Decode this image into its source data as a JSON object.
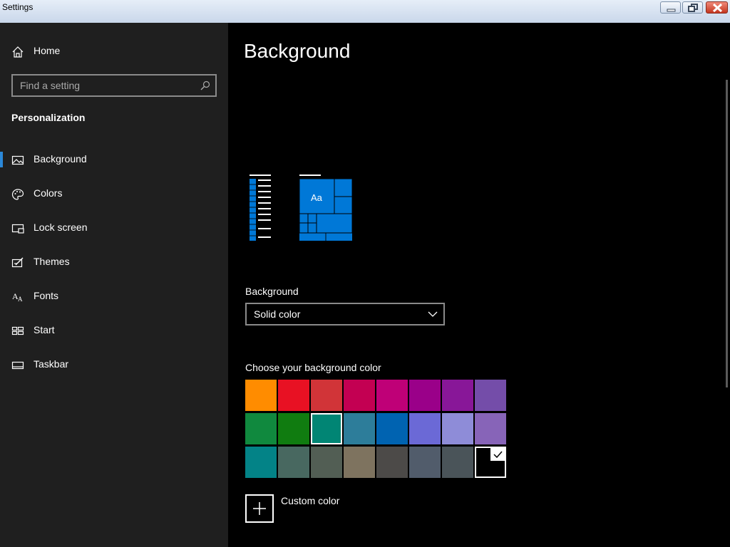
{
  "window": {
    "title": "Settings",
    "controls": {
      "minimize": "minimize",
      "maximize": "restore",
      "close": "close"
    }
  },
  "sidebar": {
    "home_label": "Home",
    "search_placeholder": "Find a setting",
    "section_title": "Personalization",
    "items": [
      {
        "label": "Background",
        "icon": "picture-icon",
        "active": true
      },
      {
        "label": "Colors",
        "icon": "palette-icon",
        "active": false
      },
      {
        "label": "Lock screen",
        "icon": "lock-screen-icon",
        "active": false
      },
      {
        "label": "Themes",
        "icon": "themes-icon",
        "active": false
      },
      {
        "label": "Fonts",
        "icon": "fonts-icon",
        "active": false
      },
      {
        "label": "Start",
        "icon": "start-icon",
        "active": false
      },
      {
        "label": "Taskbar",
        "icon": "taskbar-icon",
        "active": false
      }
    ],
    "accent_color": "#2b88d8"
  },
  "main": {
    "title": "Background",
    "preview": {
      "tile_text": "Aa",
      "accent": "#0078d7"
    },
    "background_label": "Background",
    "background_value": "Solid color",
    "color_label": "Choose your background color",
    "colors": [
      [
        "#ff8c00",
        "#e81123",
        "#d13438",
        "#c30052",
        "#bf0077",
        "#9a0089",
        "#881798",
        "#744da9"
      ],
      [
        "#10893e",
        "#107c10",
        "#018574",
        "#2d7d9a",
        "#0063b1",
        "#6b69d6",
        "#8e8cd8",
        "#8764b8"
      ],
      [
        "#038387",
        "#486860",
        "#525e54",
        "#7e735f",
        "#4c4a48",
        "#515c6b",
        "#4a5459",
        "#000000"
      ]
    ],
    "selected_color_index": [
      2,
      7
    ],
    "highlighted_color_index": [
      1,
      2
    ],
    "custom_color_label": "Custom color"
  }
}
